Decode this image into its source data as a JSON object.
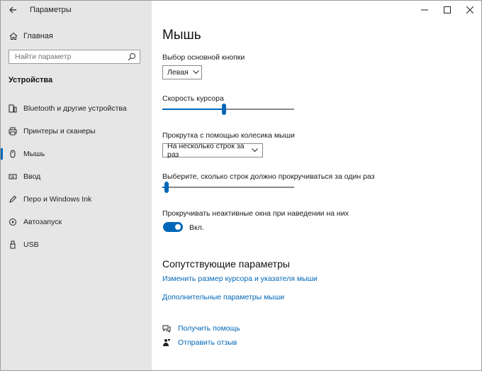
{
  "window": {
    "title": "Параметры",
    "controls": {
      "minimize": "—",
      "maximize": "☐",
      "close": "✕"
    }
  },
  "sidebar": {
    "home_label": "Главная",
    "search_placeholder": "Найти параметр",
    "section_title": "Устройства",
    "items": [
      {
        "label": "Bluetooth и другие устройства",
        "icon": "bluetooth-devices-icon"
      },
      {
        "label": "Принтеры и сканеры",
        "icon": "printer-icon"
      },
      {
        "label": "Мышь",
        "icon": "mouse-icon",
        "active": true
      },
      {
        "label": "Ввод",
        "icon": "keyboard-icon"
      },
      {
        "label": "Перо и Windows Ink",
        "icon": "pen-icon"
      },
      {
        "label": "Автозапуск",
        "icon": "autoplay-icon"
      },
      {
        "label": "USB",
        "icon": "usb-icon"
      }
    ]
  },
  "main": {
    "title": "Мышь",
    "primary_button": {
      "label": "Выбор основной кнопки",
      "value": "Левая"
    },
    "cursor_speed": {
      "label": "Скорость курсора",
      "value_fraction": 0.47
    },
    "scroll_mode": {
      "label": "Прокрутка с помощью колесика мыши",
      "value": "На несколько строк за раз"
    },
    "scroll_lines": {
      "label": "Выберите, сколько строк должно прокручиваться за один раз",
      "value_fraction": 0.03
    },
    "inactive_scroll": {
      "label": "Прокручивать неактивные окна при наведении на них",
      "state_label": "Вкл.",
      "on": true
    },
    "related": {
      "title": "Сопутствующие параметры",
      "links": [
        "Изменить размер курсора и указателя мыши",
        "Дополнительные параметры мыши"
      ]
    },
    "help": [
      {
        "label": "Получить помощь",
        "icon": "help-chat-icon"
      },
      {
        "label": "Отправить отзыв",
        "icon": "feedback-icon"
      }
    ]
  },
  "colors": {
    "accent": "#0067b8",
    "sidebar_bg": "#e6e6e6"
  }
}
